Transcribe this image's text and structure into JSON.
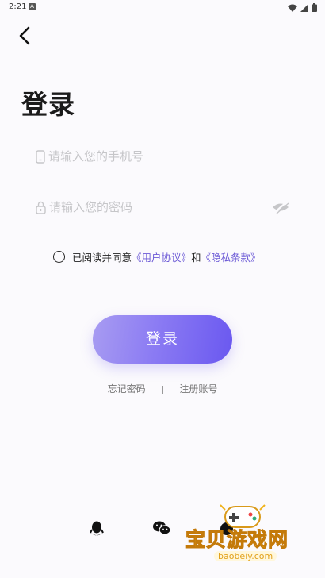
{
  "status": {
    "time": "2:21",
    "notif_icon": "A"
  },
  "header": {
    "title": "登录"
  },
  "phone": {
    "placeholder": "请输入您的手机号"
  },
  "password": {
    "placeholder": "请输入您的密码"
  },
  "agreement": {
    "prefix": "已阅读并同意",
    "user_link": "《用户协议》",
    "and": "和",
    "privacy_link": "《隐私条款》"
  },
  "login_button": "登录",
  "links": {
    "forgot": "忘记密码",
    "separator": "|",
    "register": "注册账号"
  },
  "social": [
    "qq-icon",
    "wechat-icon",
    "other-login-icon"
  ],
  "watermark": {
    "text": "宝贝游戏网",
    "url": "baobeiy.com"
  },
  "colors": {
    "accent": "#6a58f0",
    "link": "#6c5ad6",
    "background": "#fbfafd"
  }
}
